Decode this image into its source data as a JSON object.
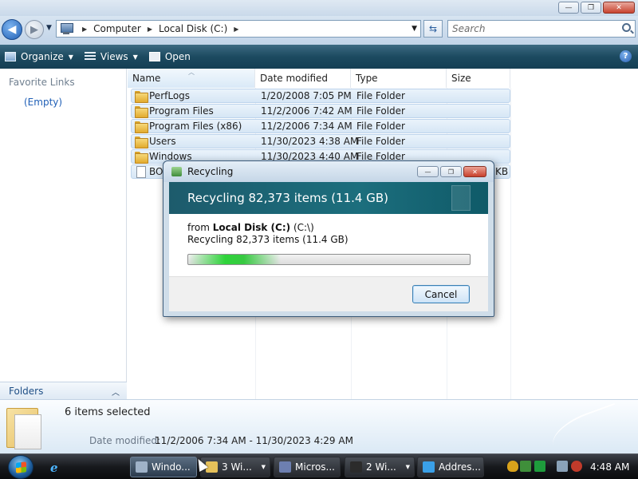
{
  "window": {
    "minimize_glyph": "—",
    "restore_glyph": "❐",
    "close_glyph": "✕"
  },
  "addressbar": {
    "back_glyph": "◀",
    "forward_glyph": "▶",
    "crumbs": [
      "Computer",
      "Local Disk (C:)"
    ],
    "separator": "▶",
    "search_placeholder": "Search"
  },
  "toolbar": {
    "organize": "Organize",
    "views": "Views",
    "open": "Open",
    "help": "?"
  },
  "nav": {
    "favorite_links": "Favorite Links",
    "empty": "(Empty)",
    "folders": "Folders"
  },
  "columns": {
    "name": "Name",
    "date_modified": "Date modified",
    "type": "Type",
    "size": "Size"
  },
  "files": [
    {
      "name": "PerfLogs",
      "date": "1/20/2008 7:05 PM",
      "type": "File Folder",
      "size": "",
      "kind": "folder",
      "selected": true
    },
    {
      "name": "Program Files",
      "date": "11/2/2006 7:42 AM",
      "type": "File Folder",
      "size": "",
      "kind": "folder",
      "selected": true
    },
    {
      "name": "Program Files (x86)",
      "date": "11/2/2006 7:34 AM",
      "type": "File Folder",
      "size": "",
      "kind": "folder",
      "selected": true
    },
    {
      "name": "Users",
      "date": "11/30/2023 4:38 AM",
      "type": "File Folder",
      "size": "",
      "kind": "folder",
      "selected": true
    },
    {
      "name": "Windows",
      "date": "11/30/2023 4:40 AM",
      "type": "File Folder",
      "size": "",
      "kind": "folder",
      "selected": true
    },
    {
      "name": "BO",
      "date": "",
      "type": "",
      "size": "KB",
      "kind": "file",
      "selected": true
    }
  ],
  "details": {
    "count": "6 items selected",
    "date_label": "Date modified:",
    "date_value": "11/2/2006 7:34 AM - 11/30/2023 4:29 AM"
  },
  "dialog": {
    "title": "Recycling",
    "heading": "Recycling 82,373 items (11.4 GB)",
    "from_prefix": "from",
    "from_bold": "Local Disk (C:)",
    "from_suffix": "(C:\\)",
    "sub": "Recycling 82,373 items (11.4 GB)",
    "progress": 0.33,
    "cancel": "Cancel"
  },
  "taskbar": {
    "buttons": [
      {
        "label": "Windo...",
        "color": "#9fb2c8",
        "active": true,
        "arrow": false
      },
      {
        "label": "3 Wi...",
        "color": "#e6c15a",
        "active": false,
        "arrow": true
      },
      {
        "label": "Micros...",
        "color": "#6d7fb0",
        "active": false,
        "arrow": false
      },
      {
        "label": "2 Wi...",
        "color": "#2b2b2b",
        "active": false,
        "arrow": true
      },
      {
        "label": "Addres...",
        "color": "#3aa0e8",
        "active": false,
        "arrow": false
      }
    ],
    "clock": "4:48 AM"
  },
  "colors": {
    "toolbar": "#1c4a60",
    "dialog_header": "#1c6e7d",
    "progress": "#2ed43a",
    "link": "#1f5fb6"
  }
}
